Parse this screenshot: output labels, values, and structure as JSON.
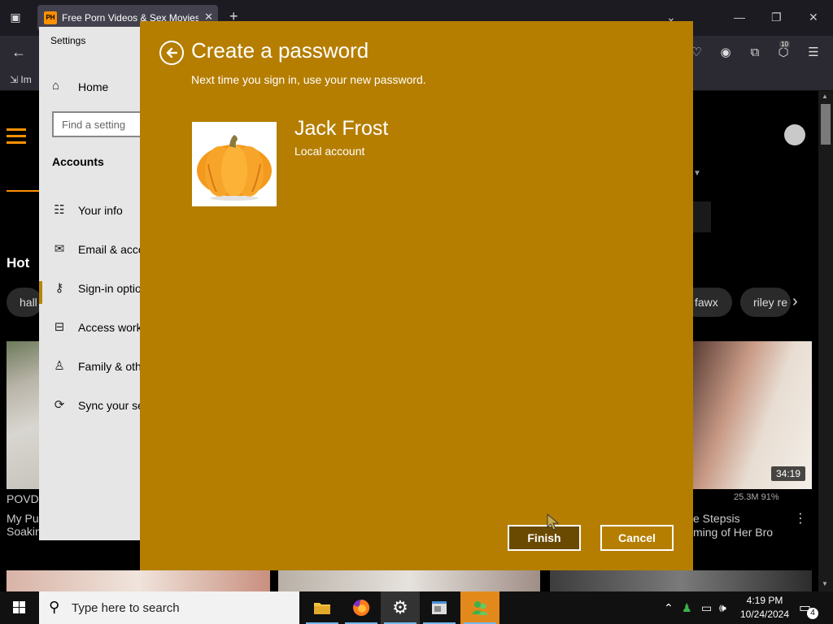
{
  "browser": {
    "tab_title": "Free Porn Videos & Sex Movies",
    "tab_favicon": "PH",
    "new_tab": "+",
    "close_tab": "✕",
    "back": "←",
    "bookmark": "Im",
    "extension_badge": "10",
    "window_minimize": "—",
    "window_restore": "❐",
    "window_close": "✕"
  },
  "webpage": {
    "hot_heading": "Hot",
    "pills": [
      "hall",
      "fawx",
      "riley re"
    ],
    "video_left": {
      "channel": "POVD",
      "title_line1": "My Pu",
      "title_line2": "Soakin"
    },
    "video_right": {
      "duration": "34:19",
      "stats": "25.3M  91%",
      "title_line1": "e Stepsis",
      "title_line2": "ming of Her Bro"
    }
  },
  "settings": {
    "window_title": "Settings",
    "home": "Home",
    "search_placeholder": "Find a setting",
    "section": "Accounts",
    "items": [
      {
        "label": "Your info",
        "icon": "person-list-icon"
      },
      {
        "label": "Email & acco",
        "icon": "email-icon"
      },
      {
        "label": "Sign-in optio",
        "icon": "key-icon"
      },
      {
        "label": "Access work",
        "icon": "briefcase-icon"
      },
      {
        "label": "Family & oth",
        "icon": "family-icon"
      },
      {
        "label": "Sync your se",
        "icon": "sync-icon"
      }
    ]
  },
  "dialog": {
    "title": "Create a password",
    "subtitle": "Next time you sign in, use your new password.",
    "user_name": "Jack Frost",
    "account_type": "Local account",
    "finish_label": "Finish",
    "cancel_label": "Cancel",
    "background_color": "#b57e00"
  },
  "taskbar": {
    "search_placeholder": "Type here to search",
    "time": "4:19 PM",
    "date": "10/24/2024",
    "notification_count": "4"
  }
}
